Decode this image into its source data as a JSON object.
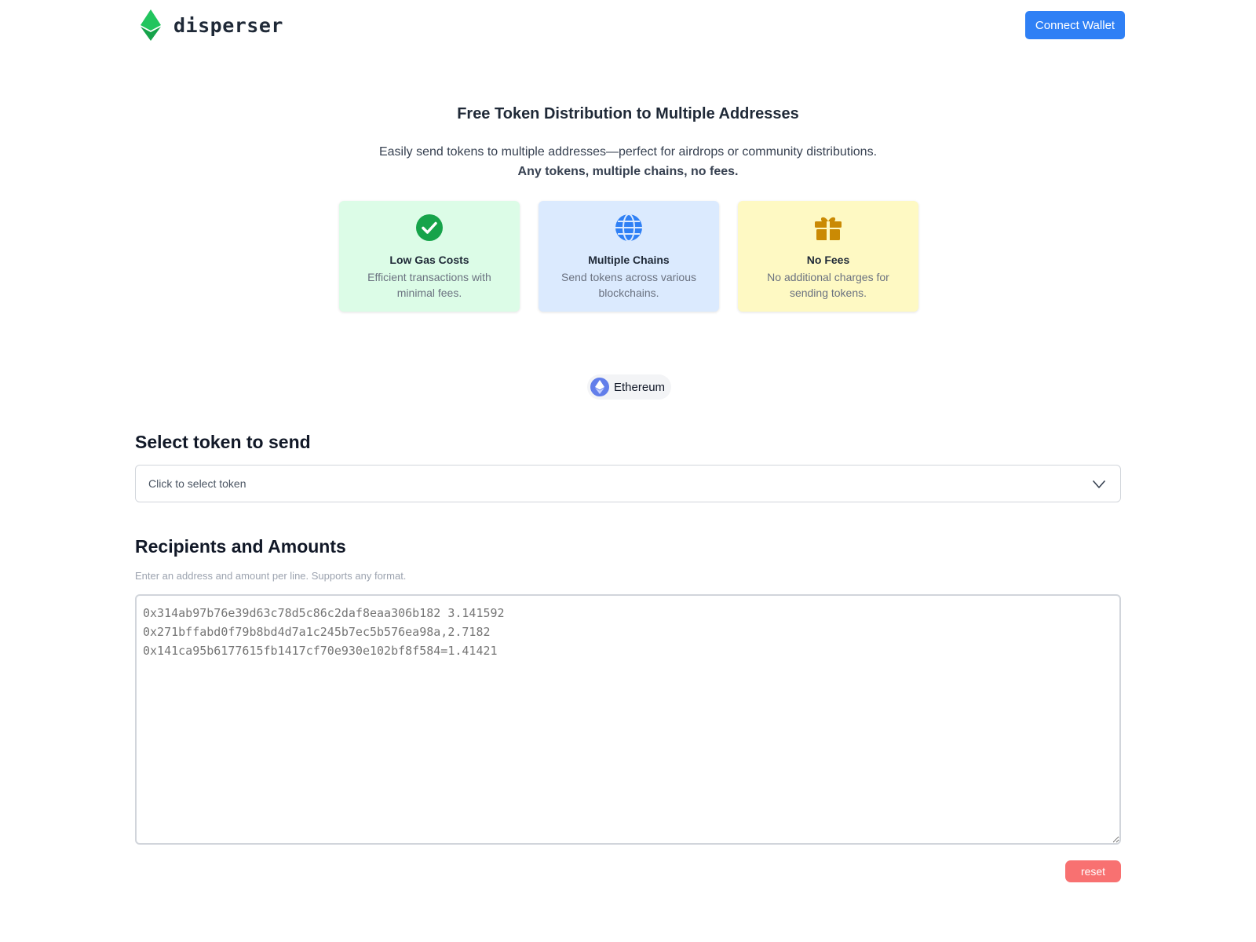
{
  "header": {
    "logo_text": "disperser",
    "connect_label": "Connect Wallet",
    "brand_color": "#22c55e",
    "accent_color": "#2f80f5"
  },
  "hero": {
    "title": "Free Token Distribution to Multiple Addresses",
    "subtitle": "Easily send tokens to multiple addresses—perfect for airdrops or community distributions.",
    "subtitle_bold": "Any tokens, multiple chains, no fees."
  },
  "features": [
    {
      "icon": "check-circle-icon",
      "title": "Low Gas Costs",
      "desc": "Efficient transactions with minimal fees."
    },
    {
      "icon": "globe-icon",
      "title": "Multiple Chains",
      "desc": "Send tokens across various blockchains."
    },
    {
      "icon": "gift-icon",
      "title": "No Fees",
      "desc": "No additional charges for sending tokens."
    }
  ],
  "chain": {
    "icon": "ethereum-icon",
    "label": "Ethereum"
  },
  "token_section": {
    "title": "Select token to send",
    "placeholder": "Click to select token"
  },
  "recipients_section": {
    "title": "Recipients and Amounts",
    "hint": "Enter an address and amount per line. Supports any format.",
    "placeholder": "0x314ab97b76e39d63c78d5c86c2daf8eaa306b182 3.141592\n0x271bffabd0f79b8bd4d7a1c245b7ec5b576ea98a,2.7182\n0x141ca95b6177615fb1417cf70e930e102bf8f584=1.41421",
    "reset_label": "reset"
  }
}
